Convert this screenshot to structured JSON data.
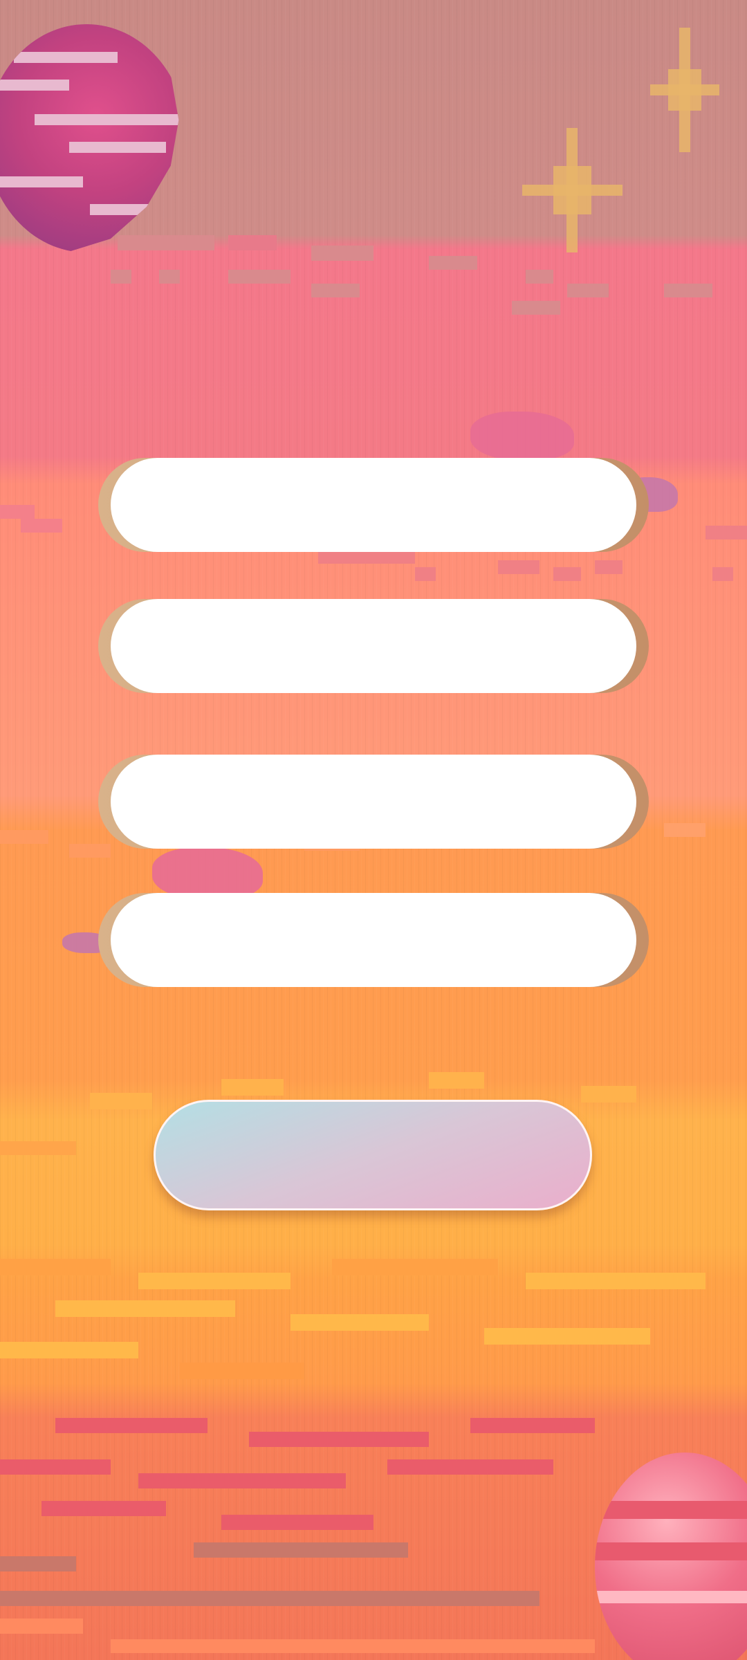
{
  "form": {
    "fields": [
      {
        "value": "",
        "placeholder": ""
      },
      {
        "value": "",
        "placeholder": ""
      },
      {
        "value": "",
        "placeholder": ""
      },
      {
        "value": "",
        "placeholder": ""
      }
    ],
    "submit_label": ""
  },
  "decor": {
    "planet_top": "pink-planet",
    "planet_bottom": "red-planet",
    "stars": [
      "sparkle-star",
      "sparkle-star"
    ],
    "clouds": [
      "pixel-cloud",
      "pixel-cloud"
    ]
  },
  "colors": {
    "sky_top": "#c98a85",
    "band_pink": "#f47a86",
    "band_salmon": "#ff9a78",
    "band_orange": "#ff9d4d",
    "band_yellow": "#ffb24c",
    "field_fill": "#ffffff",
    "field_rim": "#c9a27a",
    "button_gradient_start": "#b3dfe4",
    "button_gradient_end": "#eaaecb"
  }
}
